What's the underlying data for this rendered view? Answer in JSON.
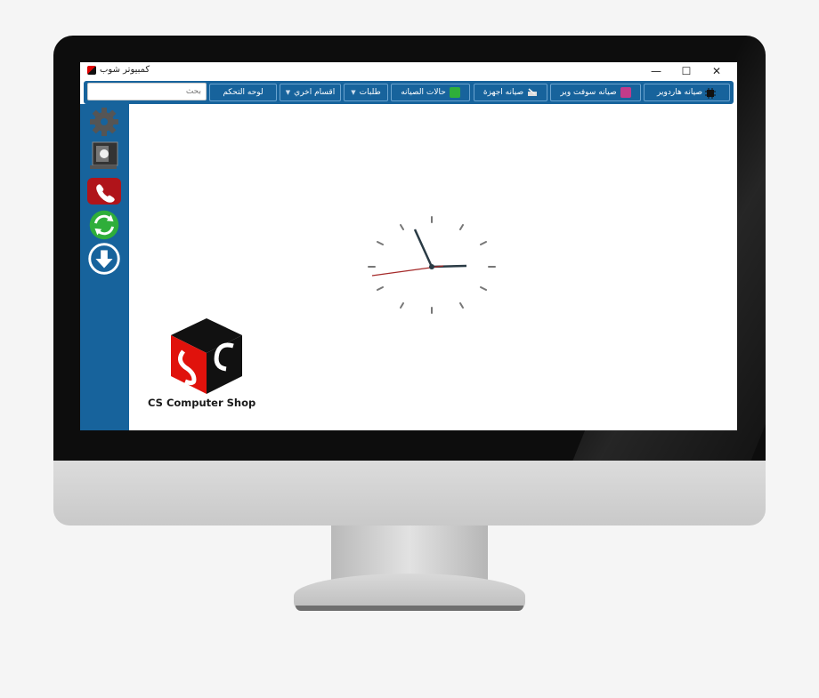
{
  "window": {
    "title": "كمبيوتر شوب",
    "controls": {
      "minimize": "—",
      "maximize": "☐",
      "close": "✕"
    }
  },
  "toolbar": {
    "hardware": "صيانه هاردوير",
    "software": "صيانه سوفت وير",
    "devices": "صيانه اجهزة",
    "status": "حالات الصيانه",
    "orders": "طلبات",
    "other": "اقسام اخري",
    "dashboard": "لوحه التحكم",
    "search_placeholder": "بحث"
  },
  "logo": {
    "text": "CS Computer Shop"
  },
  "colors": {
    "accent": "#17639c",
    "phone_bg": "#b0141a",
    "refresh_bg": "#2fae3a",
    "logo_red": "#e0120c",
    "logo_black": "#111111"
  },
  "sidebar_icons": [
    "gear-icon",
    "computer-icon",
    "phone-icon",
    "refresh-icon",
    "download-icon"
  ]
}
